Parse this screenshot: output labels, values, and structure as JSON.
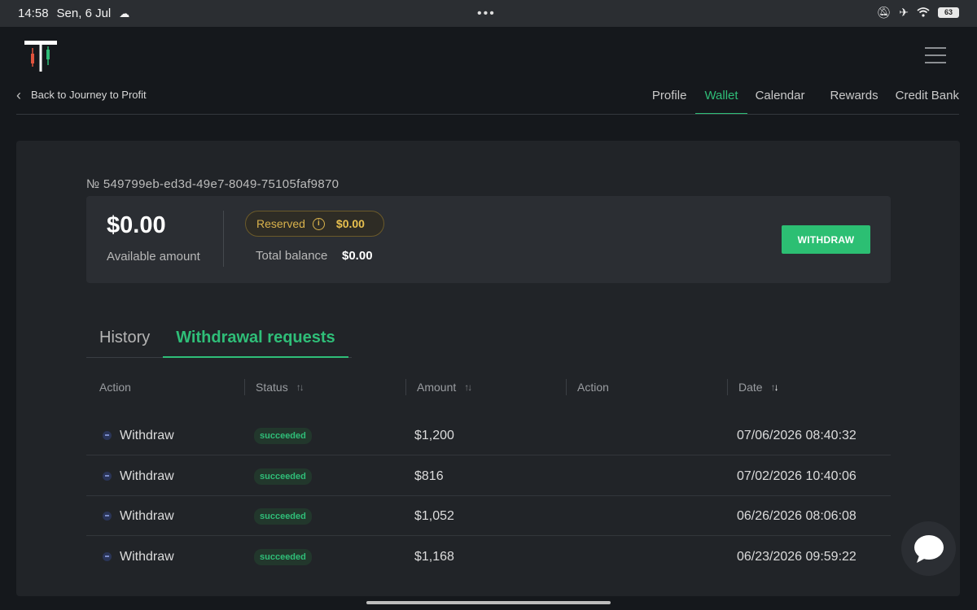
{
  "status_bar": {
    "time": "14:58",
    "date": "Sen, 6 Jul",
    "battery": "63",
    "icons": [
      "cloud-icon",
      "mute-icon",
      "airplane-icon",
      "wifi-icon",
      "battery-icon"
    ]
  },
  "header": {
    "back_label": "Back to Journey to Profit",
    "nav": [
      {
        "label": "Profile",
        "active": false
      },
      {
        "label": "Wallet",
        "active": true
      },
      {
        "label": "Calendar",
        "active": false
      },
      {
        "label": "Rewards",
        "active": false
      },
      {
        "label": "Credit Bank",
        "active": false
      }
    ]
  },
  "wallet": {
    "id": "№ 549799eb-ed3d-49e7-8049-75105faf9870",
    "available_amount": "$0.00",
    "available_label": "Available amount",
    "reserved_label": "Reserved",
    "reserved_value": "$0.00",
    "total_label": "Total balance",
    "total_value": "$0.00",
    "withdraw_label": "WITHDRAW"
  },
  "tabs": [
    {
      "label": "History",
      "active": false
    },
    {
      "label": "Withdrawal requests",
      "active": true
    }
  ],
  "table": {
    "columns": [
      "Action",
      "Status",
      "Amount",
      "Action",
      "Date"
    ],
    "rows": [
      {
        "action": "Withdraw",
        "status": "succeeded",
        "amount": "$1,200",
        "date": "07/06/2026 08:40:32"
      },
      {
        "action": "Withdraw",
        "status": "succeeded",
        "amount": "$816",
        "date": "07/02/2026 10:40:06"
      },
      {
        "action": "Withdraw",
        "status": "succeeded",
        "amount": "$1,052",
        "date": "06/26/2026 08:06:08"
      },
      {
        "action": "Withdraw",
        "status": "succeeded",
        "amount": "$1,168",
        "date": "06/23/2026 09:59:22"
      }
    ]
  },
  "colors": {
    "accent": "#2fbe78",
    "reserved": "#d9b24c",
    "background": "#15181c",
    "card": "#212428"
  }
}
